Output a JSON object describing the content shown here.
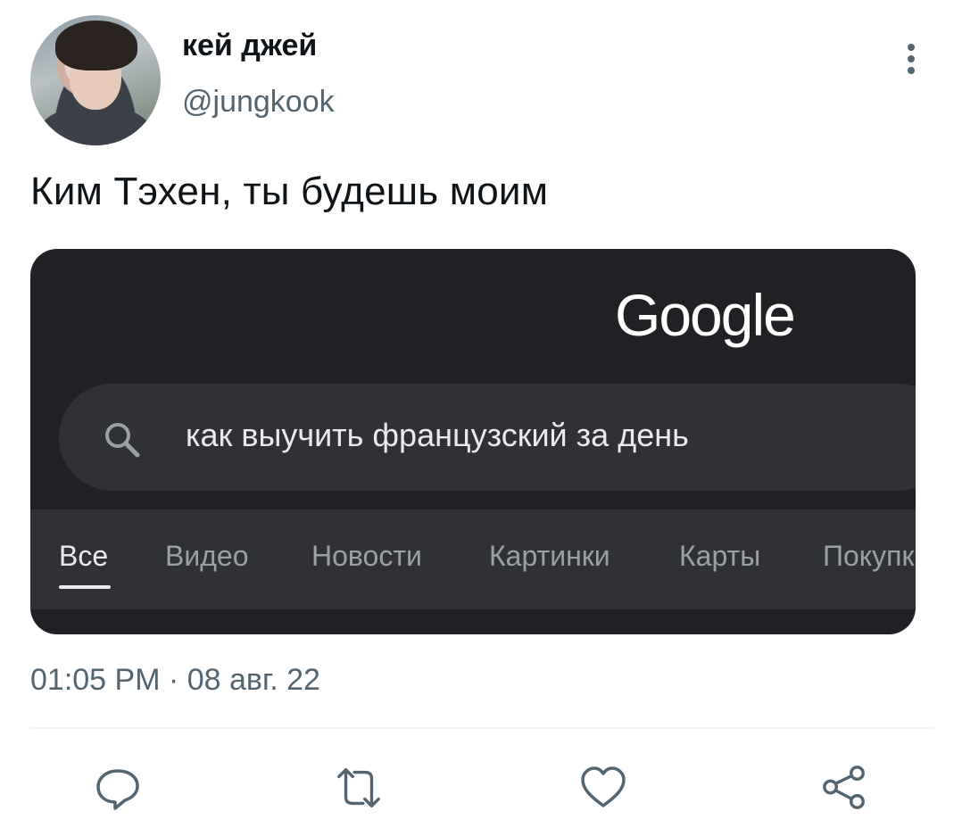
{
  "tweet": {
    "display_name": "кей джей",
    "handle": "@jungkook",
    "text": "Ким Тэхен, ты будешь моим",
    "timestamp": "01:05 PM · 08 авг. 22"
  },
  "media": {
    "logo_text": "Google",
    "search_query": "как выучить французский за день",
    "tabs": [
      {
        "label": "Все",
        "active": true
      },
      {
        "label": "Видео",
        "active": false
      },
      {
        "label": "Новости",
        "active": false
      },
      {
        "label": "Картинки",
        "active": false
      },
      {
        "label": "Карты",
        "active": false
      },
      {
        "label": "Покупки",
        "active": false
      }
    ]
  },
  "actions": [
    {
      "icon": "reply-icon"
    },
    {
      "icon": "retweet-icon"
    },
    {
      "icon": "like-icon"
    },
    {
      "icon": "share-icon"
    }
  ],
  "colors": {
    "secondary_text": "#536471",
    "media_bg": "#202124",
    "searchbar_bg": "#303134"
  }
}
